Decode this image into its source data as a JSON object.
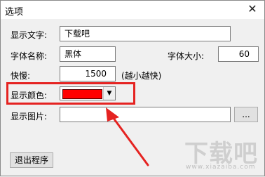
{
  "window": {
    "title": "选项",
    "close_glyph": "✕"
  },
  "text_row": {
    "label": "显示文字:",
    "value": "下载吧"
  },
  "font_row": {
    "name_label": "字体名称:",
    "name_value": "黑体",
    "size_label": "字体大小:",
    "size_value": "60"
  },
  "speed_row": {
    "label": "快慢:",
    "value": "1500",
    "hint": "(越小越快)"
  },
  "color_row": {
    "label": "显示颜色:",
    "selected_color": "#ff0000",
    "dropdown_icon": "chevron-down-icon",
    "dropdown_glyph": "▼"
  },
  "image_row": {
    "label": "显示图片:",
    "value": "",
    "browse_label": "..."
  },
  "exit_button": {
    "label": "退出程序"
  },
  "annotation": {
    "highlight_color": "#e52321"
  },
  "watermark": {
    "main": "下载吧",
    "sub": "www.xiazaiba.com"
  }
}
